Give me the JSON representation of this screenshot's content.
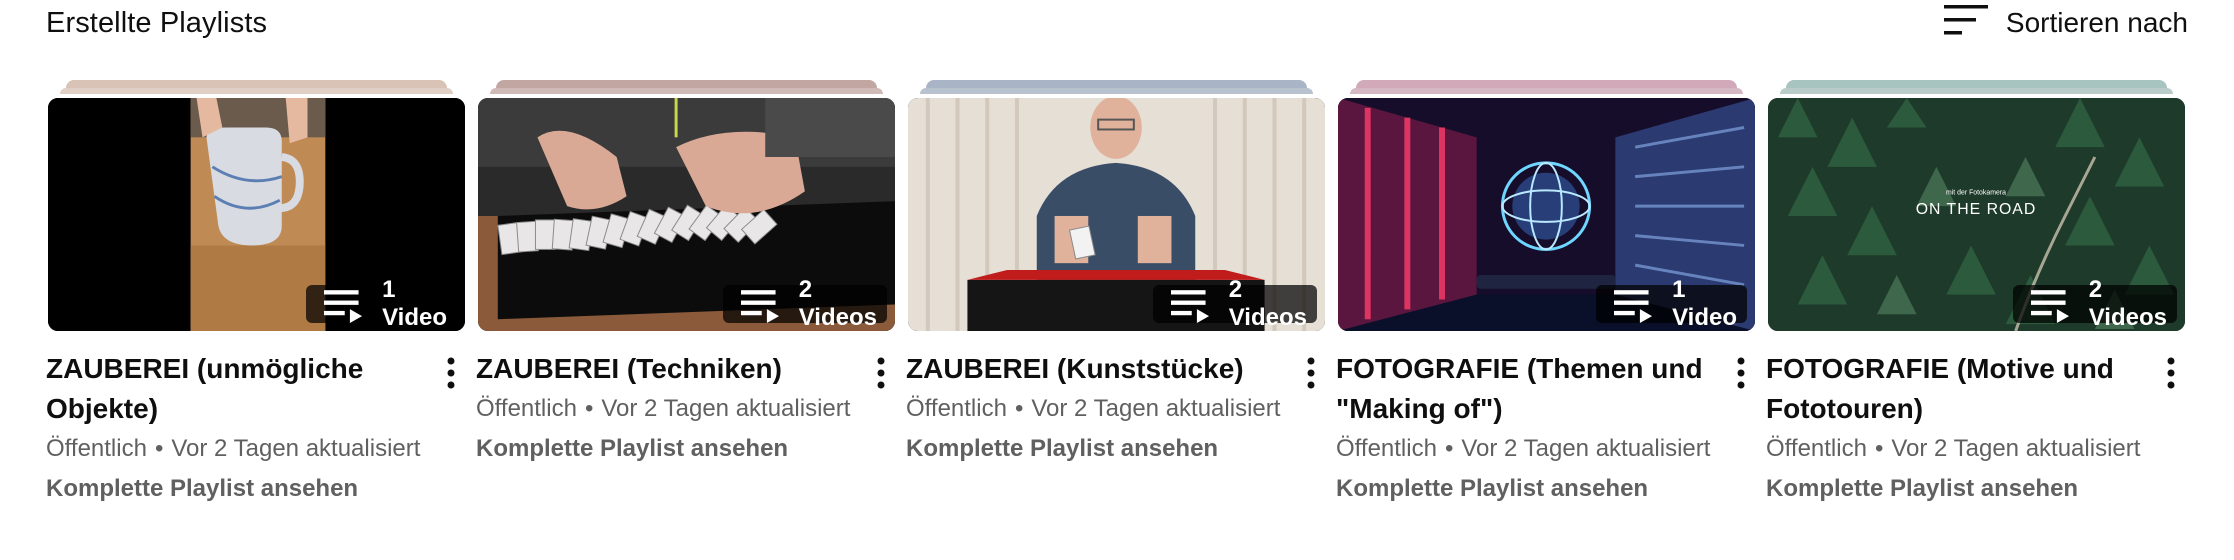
{
  "header": {
    "title": "Erstellte Playlists",
    "sort_label": "Sortieren nach",
    "sort_icon": "sort-icon"
  },
  "common": {
    "separator": "•",
    "view_full": "Komplette Playlist ansehen",
    "badge_icon": "playlist-icon",
    "menu_icon": "more-vert-icon"
  },
  "playlists": [
    {
      "title": "ZAUBEREI (unmögliche Objekte)",
      "visibility": "Öffentlich",
      "updated": "Vor 2 Tagen aktualisiert",
      "count": "1 Video",
      "stack_color": "#d8c3b6",
      "stack_color2": "#c4a796"
    },
    {
      "title": "ZAUBEREI (Techniken)",
      "visibility": "Öffentlich",
      "updated": "Vor 2 Tagen aktualisiert",
      "count": "2 Videos",
      "stack_color": "#c2a6a1",
      "stack_color2": "#a8827b"
    },
    {
      "title": "ZAUBEREI (Kunststücke)",
      "visibility": "Öffentlich",
      "updated": "Vor 2 Tagen aktualisiert",
      "count": "2 Videos",
      "stack_color": "#a9b5c6",
      "stack_color2": "#7d8fa8"
    },
    {
      "title": "FOTOGRAFIE (Themen und \"Making of\")",
      "visibility": "Öffentlich",
      "updated": "Vor 2 Tagen aktualisiert",
      "count": "1 Video",
      "stack_color": "#d2a9b8",
      "stack_color2": "#b17e94"
    },
    {
      "title": "FOTOGRAFIE (Motive und Fototouren)",
      "visibility": "Öffentlich",
      "updated": "Vor 2 Tagen aktualisiert",
      "count": "2 Videos",
      "stack_color": "#a8c4c0",
      "stack_color2": "#7fa39e",
      "thumb_overlay_small": "mit der Fotokamera",
      "thumb_overlay": "ON THE ROAD"
    }
  ]
}
